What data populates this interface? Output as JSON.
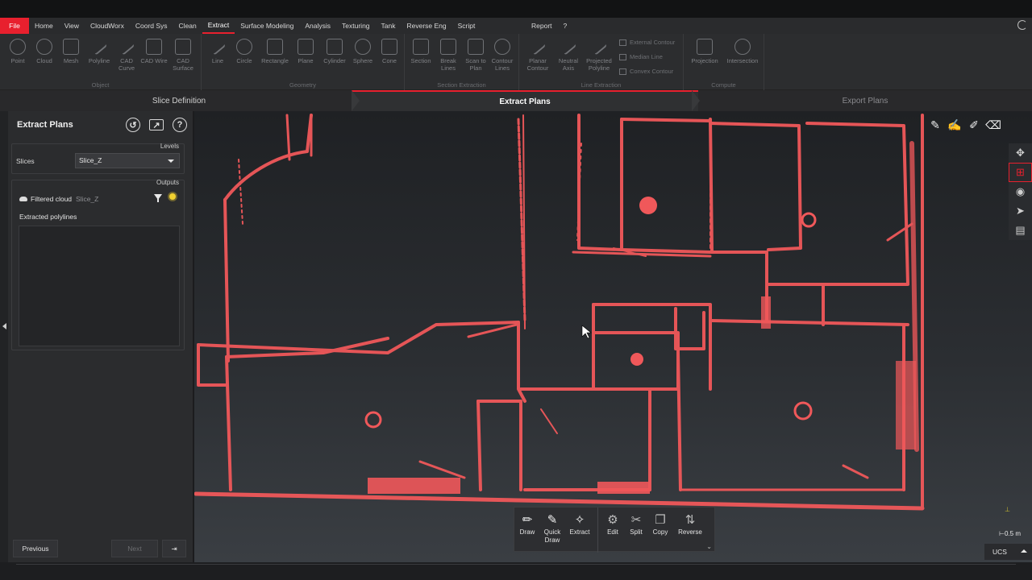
{
  "menu": {
    "file": "File",
    "items": [
      "Home",
      "View",
      "CloudWorx",
      "Coord Sys",
      "Clean",
      "Extract",
      "Surface Modeling",
      "Analysis",
      "Texturing",
      "Tank",
      "Reverse Eng",
      "Script"
    ],
    "active": "Extract",
    "right": [
      "Report",
      "?"
    ]
  },
  "ribbon": {
    "object": {
      "title": "Object",
      "buttons": [
        "Point",
        "Cloud",
        "Mesh",
        "Polyline",
        "CAD Curve",
        "CAD Wire",
        "CAD Surface"
      ]
    },
    "geometry": {
      "title": "Geometry",
      "buttons": [
        "Line",
        "Circle",
        "Rectangle",
        "Plane",
        "Cylinder",
        "Sphere",
        "Cone"
      ]
    },
    "section_extraction": {
      "title": "Section Extraction",
      "buttons": [
        "Section",
        "Break Lines",
        "Scan to Plan",
        "Contour Lines"
      ]
    },
    "line_extraction": {
      "title": "Line Extraction",
      "buttons": [
        "Planar Contour",
        "Neutral Axis",
        "Projected Polyline"
      ],
      "small": [
        "External Contour",
        "Median Line",
        "Convex Contour"
      ]
    },
    "compute": {
      "title": "Compute",
      "buttons": [
        "Projection",
        "Intersection"
      ]
    }
  },
  "steps": {
    "items": [
      "Slice Definition",
      "Extract Plans",
      "Export Plans"
    ],
    "active": "Extract Plans"
  },
  "panel": {
    "title": "Extract Plans",
    "levels_label": "Levels",
    "slices_label": "Slices",
    "slices_value": "Slice_Z",
    "outputs_label": "Outputs",
    "filtered_cloud": "Filtered cloud",
    "filtered_cloud_slice": "Slice_Z",
    "extracted_polylines": "Extracted polylines",
    "previous": "Previous",
    "next": "Next"
  },
  "floating_toolbar": {
    "buttons": [
      "Draw",
      "Quick Draw",
      "Extract",
      "Edit",
      "Split",
      "Copy",
      "Reverse"
    ]
  },
  "viewport": {
    "scale": "0.5 m",
    "ucs": "UCS",
    "scan_color": "#f0585a"
  },
  "colors": {
    "accent": "#e8202e",
    "background": "#1b1c1e"
  }
}
